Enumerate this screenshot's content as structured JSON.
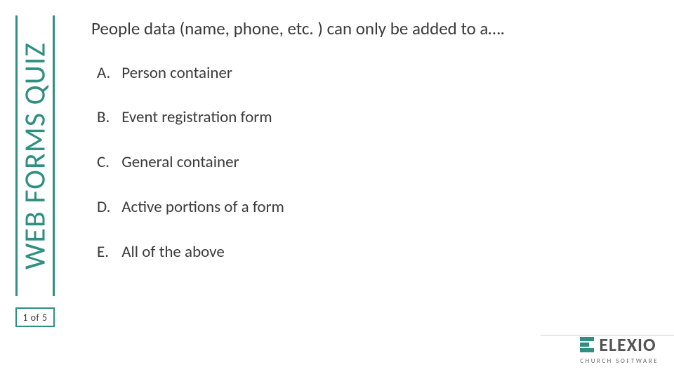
{
  "side_title": "WEB FORMS QUIZ",
  "page_counter": "1 of 5",
  "question": "People data (name, phone, etc. ) can only be added to a….",
  "options": [
    {
      "letter": "A.",
      "text": "Person container"
    },
    {
      "letter": "B.",
      "text": "Event registration form"
    },
    {
      "letter": "C.",
      "text": "General container"
    },
    {
      "letter": "D.",
      "text": "Active portions of a form"
    },
    {
      "letter": "E.",
      "text": "All of the above"
    }
  ],
  "logo": {
    "brand": "ELEXIO",
    "tagline": "CHURCH SOFTWARE"
  }
}
